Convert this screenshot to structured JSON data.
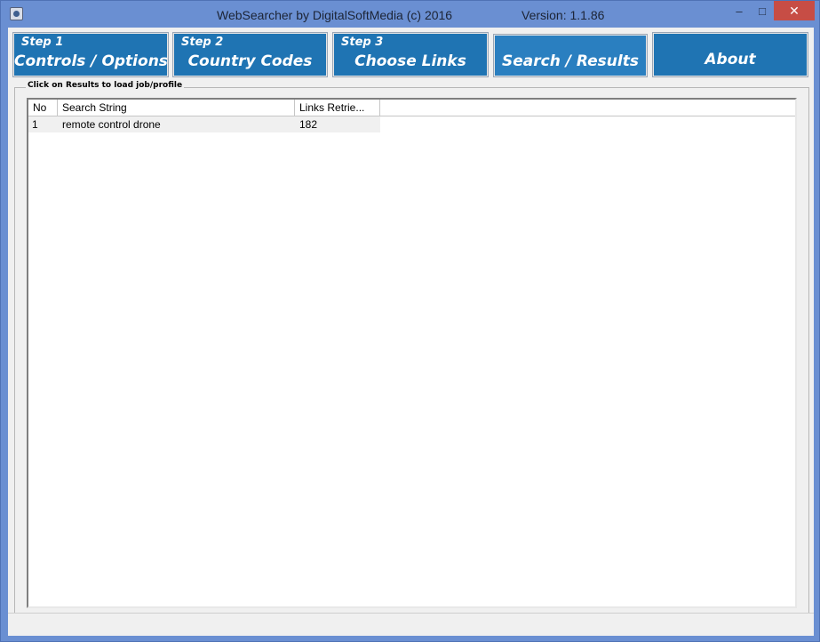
{
  "window": {
    "title": "WebSearcher by DigitalSoftMedia (c) 2016",
    "version": "Version: 1.1.86",
    "minimize_glyph": "–",
    "maximize_glyph": "□",
    "close_glyph": "✕"
  },
  "tabs": [
    {
      "step": "Step 1",
      "label": "Controls / Options"
    },
    {
      "step": "Step 2",
      "label": "Country Codes"
    },
    {
      "step": "Step 3",
      "label": "Choose Links"
    },
    {
      "step": "",
      "label": "Search / Results"
    },
    {
      "step": "",
      "label": "About"
    }
  ],
  "results": {
    "group_label": "Click on Results to load job/profile",
    "columns": [
      "No",
      "Search String",
      "Links Retrie..."
    ],
    "rows": [
      {
        "no": "1",
        "search": "remote control drone",
        "links": "182"
      }
    ]
  },
  "colors": {
    "titlebar": "#6a8fd2",
    "tab_bg": "#1f74b3",
    "close_button": "#c74d45"
  }
}
